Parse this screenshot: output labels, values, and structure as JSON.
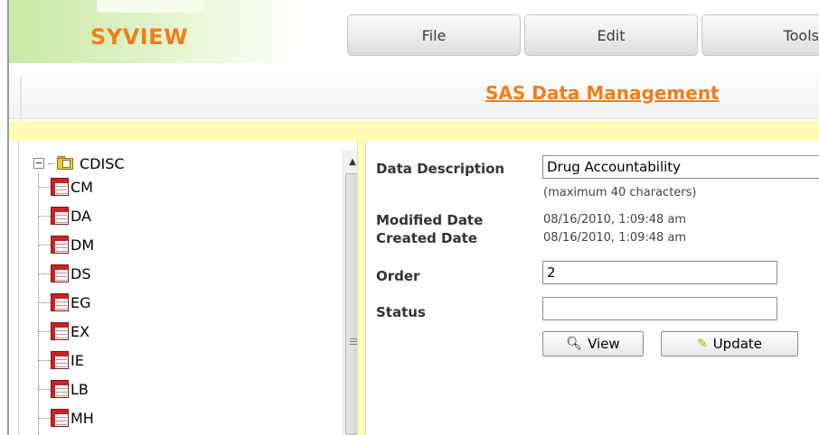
{
  "app": {
    "logo": "SYVIEW"
  },
  "menu": {
    "file": "File",
    "edit": "Edit",
    "tools": "Tools"
  },
  "page_title": "SAS Data Management",
  "tree": {
    "root": {
      "label": "CDISC",
      "icon": "library-folder-icon"
    },
    "items": [
      "CM",
      "DA",
      "DM",
      "DS",
      "EG",
      "EX",
      "IE",
      "LB",
      "MH"
    ],
    "item_icon": "dataset-icon"
  },
  "form": {
    "data_description_label": "Data Description",
    "data_description_value": "Drug Accountability",
    "max_hint": "(maximum 40 characters)",
    "modified_label": "Modified Date",
    "modified_value": "08/16/2010, 1:09:48 am",
    "created_label": "Created Date",
    "created_value": "08/16/2010, 1:09:48 am",
    "order_label": "Order",
    "order_value": "2",
    "status_label": "Status",
    "status_value": "",
    "view_button": "View",
    "update_button": "Update"
  },
  "colors": {
    "brand_orange": "#f07e1a",
    "band_yellow": "#fffcb4",
    "logo_green": "#c8eaa4"
  }
}
